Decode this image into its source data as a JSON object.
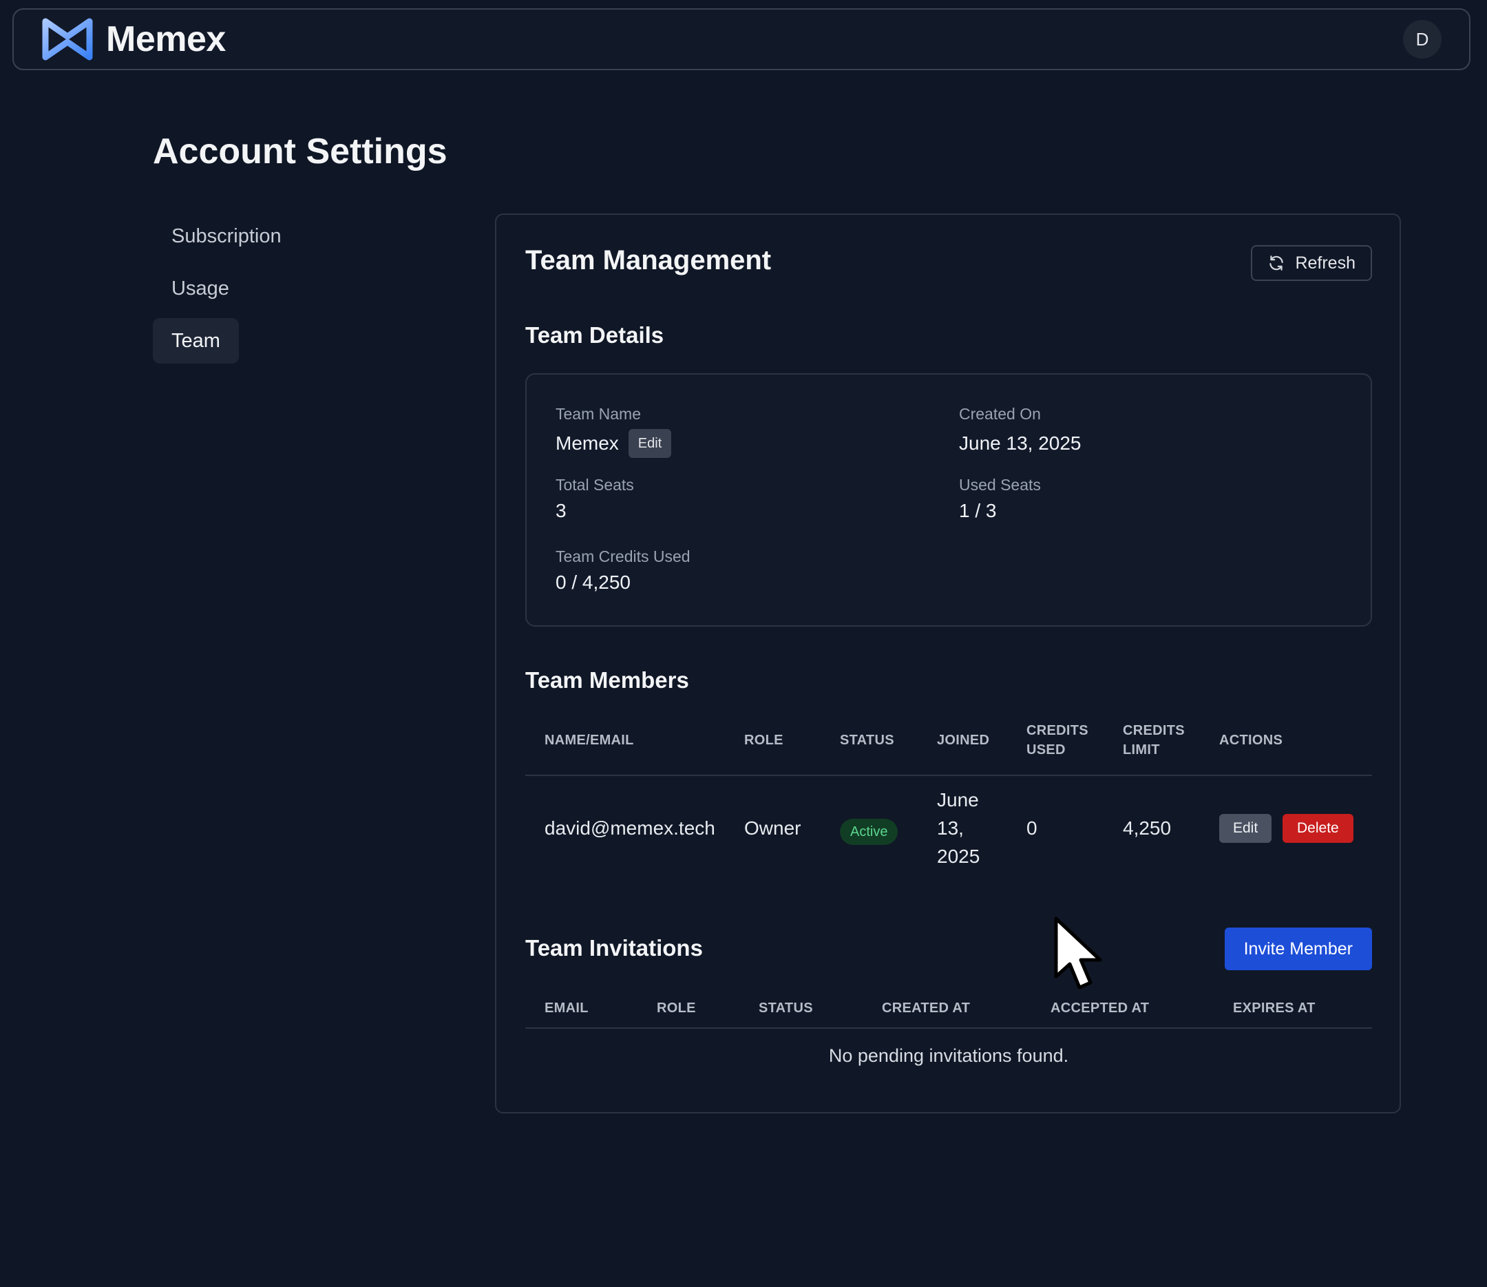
{
  "header": {
    "brand_name": "Memex",
    "avatar_initial": "D"
  },
  "page": {
    "title": "Account Settings"
  },
  "sidebar": {
    "items": [
      {
        "label": "Subscription"
      },
      {
        "label": "Usage"
      },
      {
        "label": "Team"
      }
    ],
    "active": "Team"
  },
  "team_management": {
    "title": "Team Management",
    "refresh_label": "Refresh",
    "details": {
      "title": "Team Details",
      "team_name_label": "Team Name",
      "team_name_value": "Memex",
      "edit_label": "Edit",
      "created_on_label": "Created On",
      "created_on_value": "June 13, 2025",
      "total_seats_label": "Total Seats",
      "total_seats_value": "3",
      "used_seats_label": "Used Seats",
      "used_seats_value": "1 / 3",
      "credits_used_label": "Team Credits Used",
      "credits_used_value": "0 / 4,250"
    },
    "members": {
      "title": "Team Members",
      "columns": {
        "name_email": "NAME/EMAIL",
        "role": "ROLE",
        "status": "STATUS",
        "joined": "JOINED",
        "credits_used_1": "CREDITS",
        "credits_used_2": "USED",
        "credits_limit_1": "CREDITS",
        "credits_limit_2": "LIMIT",
        "actions": "ACTIONS"
      },
      "rows": [
        {
          "email": "david@memex.tech",
          "role": "Owner",
          "status": "Active",
          "joined_1": "June",
          "joined_2": "13,",
          "joined_3": "2025",
          "credits_used": "0",
          "credits_limit": "4,250",
          "edit_label": "Edit",
          "delete_label": "Delete"
        }
      ]
    },
    "invitations": {
      "title": "Team Invitations",
      "invite_label": "Invite Member",
      "columns": {
        "email": "EMAIL",
        "role": "ROLE",
        "status": "STATUS",
        "created_at": "CREATED AT",
        "accepted_at": "ACCEPTED AT",
        "expires_at": "EXPIRES AT"
      },
      "empty_message": "No pending invitations found."
    }
  },
  "colors": {
    "background": "#0f1625",
    "accent_blue": "#1d4ed8",
    "danger_red": "#c81e1e",
    "active_green": "#5dd68d"
  },
  "icons": {
    "logo": "memex-logo-icon",
    "refresh": "refresh-icon",
    "cursor": "mouse-pointer-icon"
  }
}
